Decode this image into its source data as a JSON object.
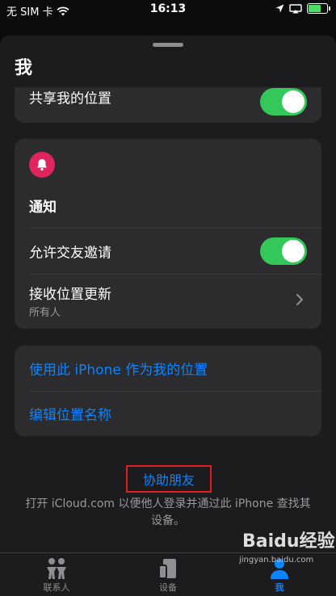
{
  "status_bar": {
    "carrier": "无 SIM 卡",
    "time": "16:13"
  },
  "page": {
    "title": "我"
  },
  "share_location": {
    "label": "共享我的位置",
    "enabled": true
  },
  "notifications": {
    "header": "通知",
    "allow_friend_requests": {
      "label": "允许交友邀请",
      "enabled": true
    },
    "receive_updates": {
      "label": "接收位置更新",
      "sublabel": "所有人"
    }
  },
  "location_actions": {
    "use_this_iphone": "使用此 iPhone 作为我的位置",
    "edit_location_name": "编辑位置名称"
  },
  "footer": {
    "help_friend": "协助朋友",
    "description": "打开 iCloud.com 以便他人登录并通过此 iPhone 查找其设备。"
  },
  "tabbar": {
    "people": "联系人",
    "devices": "设备",
    "me": "我"
  },
  "watermark": {
    "brand": "Baidu经验",
    "url": "jingyan.baidu.com"
  },
  "colors": {
    "accent": "#0a84ff",
    "toggle_on": "#34c759",
    "bell_badge": "#e0245e",
    "highlight_box": "#e02020"
  }
}
